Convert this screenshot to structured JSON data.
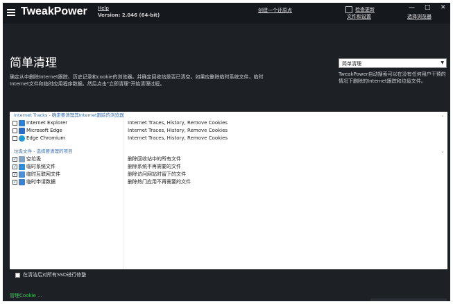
{
  "app": {
    "title": "TweakPower",
    "help_label": "Help",
    "version": "Version: 2.046 (64-bit)",
    "restore_point_label": "创建一个还原点",
    "check_update_line1": "检查更新",
    "check_update_line2": "文件和设置",
    "browser_label": "选择浏览器",
    "minimize_glyph": "—",
    "maximize_glyph": "□",
    "close_glyph": "✕"
  },
  "page": {
    "title": "简单清理",
    "description": "确定从中删除Internet跟踪、历史记录和cookie的浏览器。并确定回收站是否已清空。如果应删除临时系统文件，临时Internet文件和临时应用程序数据。然后点击\"立即清理\"开始清理过程。",
    "mode_select_value": "简单清理",
    "mode_description": "TweakPower自动搜索可以在没有任何用户干预的情况下删除的Internet跟踪和垃圾文件。"
  },
  "groups": [
    {
      "header": "Internet Tracks - 确定要清理其Internet跟踪的浏览器",
      "rows": [
        {
          "name": "Internet Explorer",
          "info": "Internet Traces, History, Remove Cookies",
          "checked": false,
          "icon": "internet-explorer-icon",
          "icon_color": "#2d7fd3"
        },
        {
          "name": "Microsoft Edge",
          "info": "Internet Traces, History, Remove Cookies",
          "checked": false,
          "icon": "edge-icon",
          "icon_color": "#2a6dc9"
        },
        {
          "name": "Edge Chromium",
          "info": "Internet Traces, History, Remove Cookies",
          "checked": false,
          "icon": "edge-chromium-icon",
          "icon_color": "#1f9bd1"
        }
      ]
    },
    {
      "header": "垃圾文件 - 选择要清理的项目",
      "rows": [
        {
          "name": "空垃圾",
          "info": "删除回收站中的所有文件",
          "checked": true,
          "icon": "recycle-bin-icon",
          "icon_color": "#7fa3c4"
        },
        {
          "name": "临时系统文件",
          "info": "删除系统不再需要的文件",
          "checked": true,
          "icon": "windows-icon",
          "icon_color": "#2f8de0"
        },
        {
          "name": "临时互联网文件",
          "info": "删除访问网站时留下的文件",
          "checked": true,
          "icon": "internet-files-icon",
          "icon_color": "#4a90d9"
        },
        {
          "name": "临时申请数据",
          "info": "删除热门应用不再需要的文件",
          "checked": true,
          "icon": "app-data-icon",
          "icon_color": "#3b7fcf"
        }
      ]
    }
  ],
  "ssd_option_label": "在清洁后对所有SSD进行修整",
  "manage_cookies_label": "管理Cookie ...",
  "colors": {
    "background": "#1d2126",
    "titlebar": "#15181c",
    "link_blue": "#3a6fb0",
    "accent_green": "#3fc35a"
  }
}
